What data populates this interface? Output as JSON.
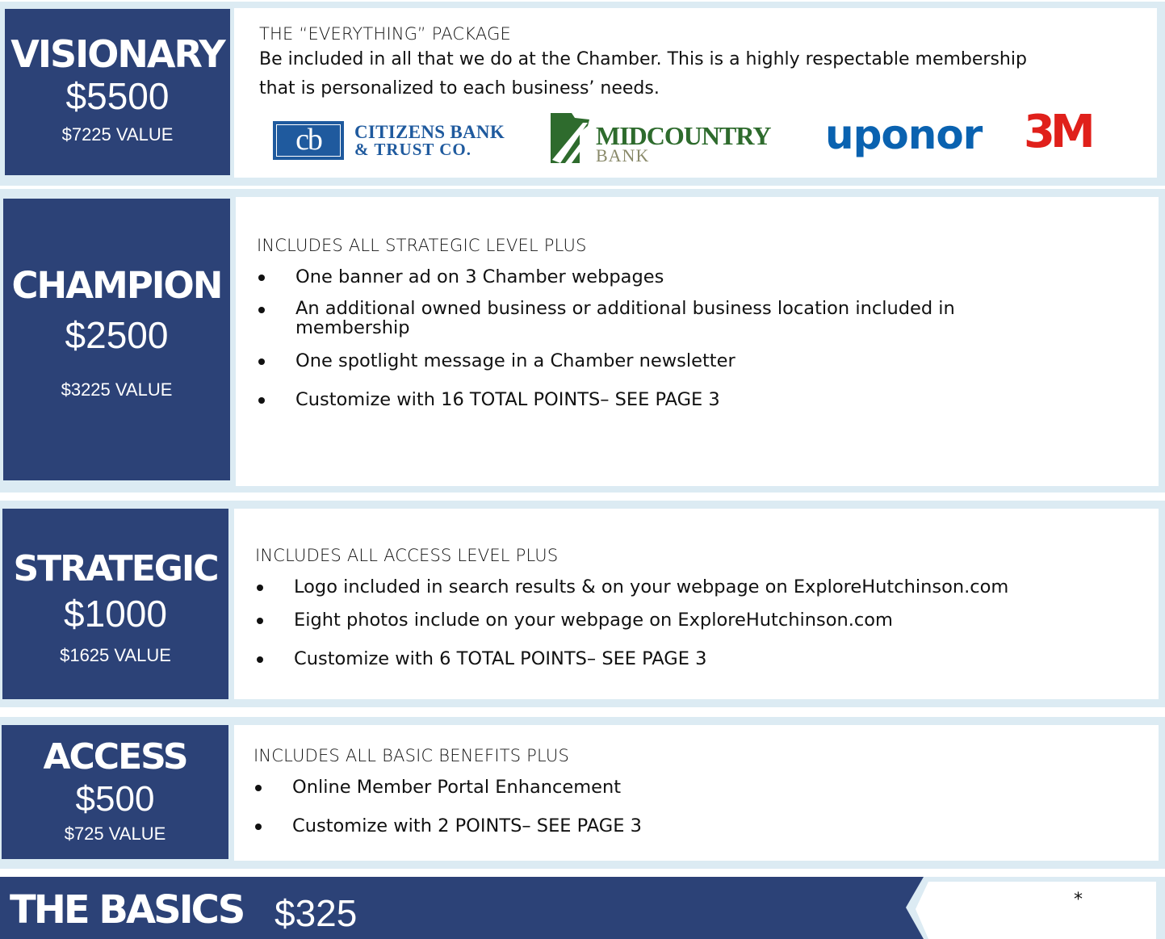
{
  "colors": {
    "navy": "#2c4277",
    "light_blue": "#dcebf3",
    "uponor_blue": "#0a62b0",
    "mm_red": "#e0201b",
    "mid_green": "#2e6b2d"
  },
  "visionary": {
    "name": "VISIONARY",
    "price": "$5500",
    "value": "$7225 VALUE",
    "heading": "THE “EVERYTHING” PACKAGE",
    "desc_line1": "Be included in all that we do at the Chamber. This is a highly respectable membership",
    "desc_line2": "that is personalized to each business’ needs.",
    "logos": {
      "citizens_mark": "cb",
      "citizens_line1": "CITIZENS BANK",
      "citizens_line2": "& TRUST CO.",
      "midcountry_line1": "MIDCOUNTRY",
      "midcountry_line2": "BANK",
      "uponor": "uponor",
      "threem": "3M"
    }
  },
  "champion": {
    "name": "CHAMPION",
    "price": "$2500",
    "value": "$3225 VALUE",
    "heading": "INCLUDES ALL STRATEGIC LEVEL PLUS",
    "bullets": [
      "One banner ad on 3 Chamber webpages",
      "An additional owned business or additional business location included in membership",
      "One spotlight message in a Chamber newsletter",
      "Customize with 16 TOTAL POINTS– SEE PAGE 3"
    ]
  },
  "strategic": {
    "name": "STRATEGIC",
    "price": "$1000",
    "value": "$1625 VALUE",
    "heading": "INCLUDES ALL ACCESS LEVEL PLUS",
    "bullets": [
      "Logo included in search results & on your webpage on ExploreHutchinson.com",
      "Eight photos include on your webpage on ExploreHutchinson.com",
      "Customize with 6 TOTAL POINTS– SEE PAGE 3"
    ]
  },
  "access": {
    "name": "ACCESS",
    "price": "$500",
    "value": "$725 VALUE",
    "heading": "INCLUDES ALL BASIC BENEFITS PLUS",
    "bullets": [
      "Online Member Portal Enhancement",
      "Customize with 2 POINTS– SEE PAGE 3"
    ]
  },
  "basics": {
    "name": "THE BASICS",
    "price": "$325",
    "asterisk": "*"
  }
}
